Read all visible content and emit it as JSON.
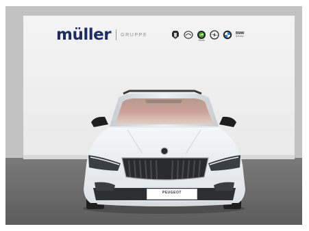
{
  "image": {
    "description_free": true,
    "brand": {
      "logo_text": "müller",
      "group_text": "GRUPPE"
    },
    "marques": [
      {
        "name": "peugeot-icon",
        "caption": ""
      },
      {
        "name": "mazda-icon",
        "caption": ""
      },
      {
        "name": "skoda-icon",
        "caption": "Skoda"
      },
      {
        "name": "opel-icon",
        "caption": ""
      },
      {
        "name": "bmw-icon",
        "caption": ""
      }
    ],
    "bmw_service": {
      "title": "BMW",
      "sub": "Service"
    },
    "plate": {
      "title": "PEUGEOT",
      "sub": ""
    },
    "colors": {
      "brand_blue": "#1c2d63",
      "wall": "#f1f1f1",
      "floor": "#6a6a6a",
      "car_body": "#eef0f2"
    }
  }
}
